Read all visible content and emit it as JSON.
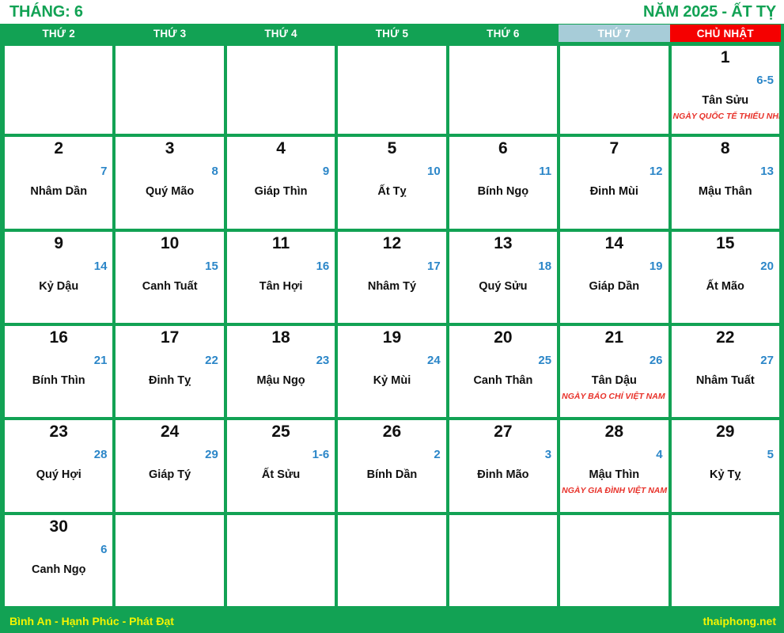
{
  "header": {
    "month_label": "THÁNG: 6",
    "year_label": "NĂM 2025 - ẤT TỴ"
  },
  "weekdays": [
    {
      "label": "THỨ 2",
      "kind": "weekday"
    },
    {
      "label": "THỨ 3",
      "kind": "weekday"
    },
    {
      "label": "THỨ 4",
      "kind": "weekday"
    },
    {
      "label": "THỨ 5",
      "kind": "weekday"
    },
    {
      "label": "THỨ 6",
      "kind": "weekday"
    },
    {
      "label": "THỨ 7",
      "kind": "saturday"
    },
    {
      "label": "CHỦ NHẬT",
      "kind": "sunday"
    }
  ],
  "colors": {
    "brand_green": "#12a254",
    "sunday_red": "#f50000",
    "saturday_blue": "#a7ccd8",
    "lunar_blue": "#2b86c8",
    "holiday_red": "#e8322a",
    "footer_yellow": "#f4f400"
  },
  "weeks": [
    [
      {
        "empty": true
      },
      {
        "empty": true
      },
      {
        "empty": true
      },
      {
        "empty": true
      },
      {
        "empty": true
      },
      {
        "empty": true
      },
      {
        "solar": "1",
        "lunar": "6-5",
        "canchi": "Tân Sửu",
        "holiday": "NGÀY QUỐC TẾ THIẾU NHI"
      }
    ],
    [
      {
        "solar": "2",
        "lunar": "7",
        "canchi": "Nhâm Dần",
        "holiday": ""
      },
      {
        "solar": "3",
        "lunar": "8",
        "canchi": "Quý Mão",
        "holiday": ""
      },
      {
        "solar": "4",
        "lunar": "9",
        "canchi": "Giáp Thìn",
        "holiday": ""
      },
      {
        "solar": "5",
        "lunar": "10",
        "canchi": "Ất Tỵ",
        "holiday": ""
      },
      {
        "solar": "6",
        "lunar": "11",
        "canchi": "Bính Ngọ",
        "holiday": ""
      },
      {
        "solar": "7",
        "lunar": "12",
        "canchi": "Đinh Mùi",
        "holiday": ""
      },
      {
        "solar": "8",
        "lunar": "13",
        "canchi": "Mậu Thân",
        "holiday": ""
      }
    ],
    [
      {
        "solar": "9",
        "lunar": "14",
        "canchi": "Kỷ Dậu",
        "holiday": ""
      },
      {
        "solar": "10",
        "lunar": "15",
        "canchi": "Canh Tuất",
        "holiday": ""
      },
      {
        "solar": "11",
        "lunar": "16",
        "canchi": "Tân Hợi",
        "holiday": ""
      },
      {
        "solar": "12",
        "lunar": "17",
        "canchi": "Nhâm Tý",
        "holiday": ""
      },
      {
        "solar": "13",
        "lunar": "18",
        "canchi": "Quý Sửu",
        "holiday": ""
      },
      {
        "solar": "14",
        "lunar": "19",
        "canchi": "Giáp Dần",
        "holiday": ""
      },
      {
        "solar": "15",
        "lunar": "20",
        "canchi": "Ất Mão",
        "holiday": ""
      }
    ],
    [
      {
        "solar": "16",
        "lunar": "21",
        "canchi": "Bính Thìn",
        "holiday": ""
      },
      {
        "solar": "17",
        "lunar": "22",
        "canchi": "Đinh Tỵ",
        "holiday": ""
      },
      {
        "solar": "18",
        "lunar": "23",
        "canchi": "Mậu Ngọ",
        "holiday": ""
      },
      {
        "solar": "19",
        "lunar": "24",
        "canchi": "Kỷ Mùi",
        "holiday": ""
      },
      {
        "solar": "20",
        "lunar": "25",
        "canchi": "Canh Thân",
        "holiday": ""
      },
      {
        "solar": "21",
        "lunar": "26",
        "canchi": "Tân Dậu",
        "holiday": "NGÀY BÁO CHÍ VIỆT NAM"
      },
      {
        "solar": "22",
        "lunar": "27",
        "canchi": "Nhâm Tuất",
        "holiday": ""
      }
    ],
    [
      {
        "solar": "23",
        "lunar": "28",
        "canchi": "Quý Hợi",
        "holiday": ""
      },
      {
        "solar": "24",
        "lunar": "29",
        "canchi": "Giáp Tý",
        "holiday": ""
      },
      {
        "solar": "25",
        "lunar": "1-6",
        "canchi": "Ất Sửu",
        "holiday": ""
      },
      {
        "solar": "26",
        "lunar": "2",
        "canchi": "Bính Dần",
        "holiday": ""
      },
      {
        "solar": "27",
        "lunar": "3",
        "canchi": "Đinh Mão",
        "holiday": ""
      },
      {
        "solar": "28",
        "lunar": "4",
        "canchi": "Mậu Thìn",
        "holiday": "NGÀY GIA ĐÌNH VIỆT NAM"
      },
      {
        "solar": "29",
        "lunar": "5",
        "canchi": "Kỷ Tỵ",
        "holiday": ""
      }
    ],
    [
      {
        "solar": "30",
        "lunar": "6",
        "canchi": "Canh Ngọ",
        "holiday": ""
      },
      {
        "empty": true
      },
      {
        "empty": true
      },
      {
        "empty": true
      },
      {
        "empty": true
      },
      {
        "empty": true
      },
      {
        "empty": true
      }
    ]
  ],
  "footer": {
    "slogan": "Bình An - Hạnh Phúc - Phát Đạt",
    "site": "thaiphong.net"
  }
}
